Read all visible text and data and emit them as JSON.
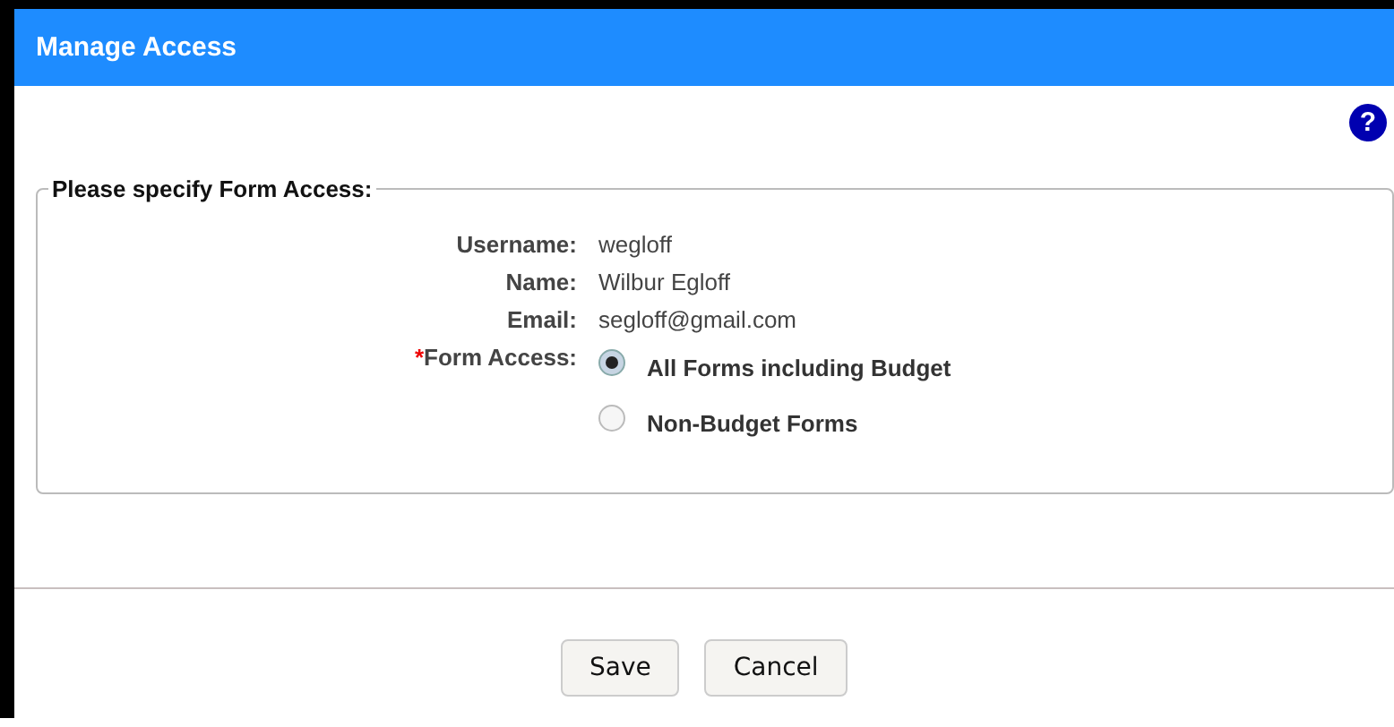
{
  "window": {
    "title": "Manage Access"
  },
  "help": {
    "glyph": "?"
  },
  "form": {
    "legend": "Please specify Form Access:",
    "fields": [
      {
        "label": "Username:",
        "value": "wegloff"
      },
      {
        "label": "Name:",
        "value": "Wilbur Egloff"
      },
      {
        "label": "Email:",
        "value": "segloff@gmail.com"
      }
    ],
    "access": {
      "required_mark": "*",
      "label": "Form Access:",
      "options": [
        {
          "label": "All Forms including Budget",
          "selected": true
        },
        {
          "label": "Non-Budget Forms",
          "selected": false
        }
      ]
    }
  },
  "buttons": [
    "Save",
    "Cancel"
  ]
}
